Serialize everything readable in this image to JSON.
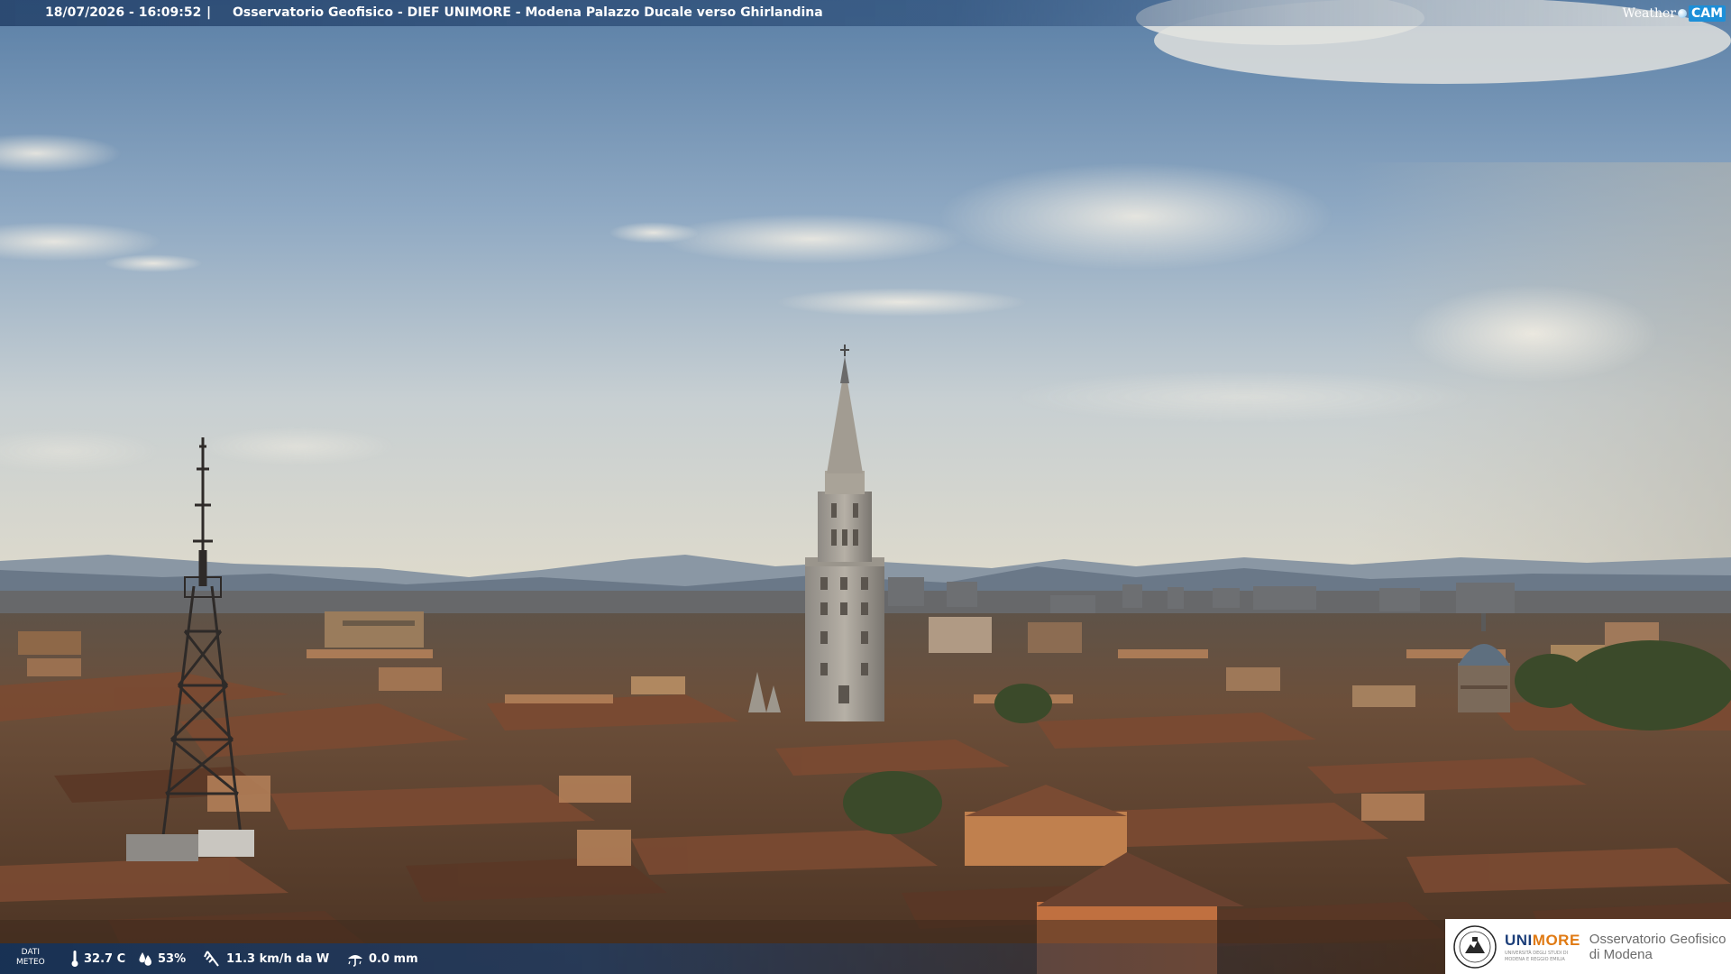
{
  "header": {
    "datetime": "18/07/2026 - 16:09:52",
    "separator": "|",
    "caption": "Osservatorio Geofisico - DIEF UNIMORE - Modena Palazzo Ducale verso Ghirlandina",
    "logo": {
      "weather_text": "Weather",
      "cam_text": "CAM"
    }
  },
  "weather_bar": {
    "label_line1": "DATI",
    "label_line2": "METEO",
    "temperature": "32.7 C",
    "humidity": "53%",
    "wind": "11.3 km/h da W",
    "rain": "0.0 mm",
    "icons": [
      "thermometer-icon",
      "droplet-icon",
      "wind-icon",
      "rain-icon"
    ]
  },
  "institution": {
    "name_part1": "UNI",
    "name_part2": "MORE",
    "name_colors": {
      "uni": "#1d3f7a",
      "more": "#e07a13"
    },
    "subline1": "UNIVERSITÀ DEGLI STUDI DI",
    "subline2": "MODENA E REGGIO EMILIA",
    "observatory_line1": "Osservatorio Geofisico",
    "observatory_line2": "di Modena"
  },
  "scene": {
    "description_colors": {
      "sky_top": "#5f83aa",
      "sky_horizon": "#d9d7c8",
      "mountains": "#6f7d8c",
      "roofs": "#6e4a33"
    }
  }
}
